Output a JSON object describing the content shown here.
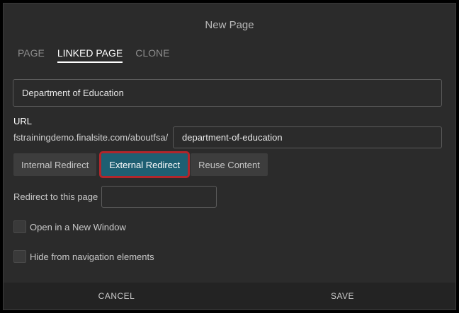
{
  "dialog": {
    "title": "New Page"
  },
  "tabs": [
    {
      "label": "PAGE",
      "active": false
    },
    {
      "label": "LINKED PAGE",
      "active": true
    },
    {
      "label": "CLONE",
      "active": false
    }
  ],
  "page_name": {
    "value": "Department of Education"
  },
  "url": {
    "label": "URL",
    "prefix": "fstrainingdemo.finalsite.com/aboutfsa/",
    "slug": "department-of-education"
  },
  "redirect_types": [
    {
      "label": "Internal Redirect",
      "active": false
    },
    {
      "label": "External Redirect",
      "active": true
    },
    {
      "label": "Reuse Content",
      "active": false
    }
  ],
  "redirect_target": {
    "label": "Redirect to this page",
    "value": ""
  },
  "options": {
    "new_window": {
      "label": "Open in a New Window",
      "checked": false
    },
    "hide_nav": {
      "label": "Hide from navigation elements",
      "checked": false
    }
  },
  "footer": {
    "cancel_label": "CANCEL",
    "save_label": "SAVE"
  },
  "colors": {
    "background": "#2b2b2b",
    "active_button": "#1e5f72",
    "highlight_outline": "#b1262b"
  }
}
